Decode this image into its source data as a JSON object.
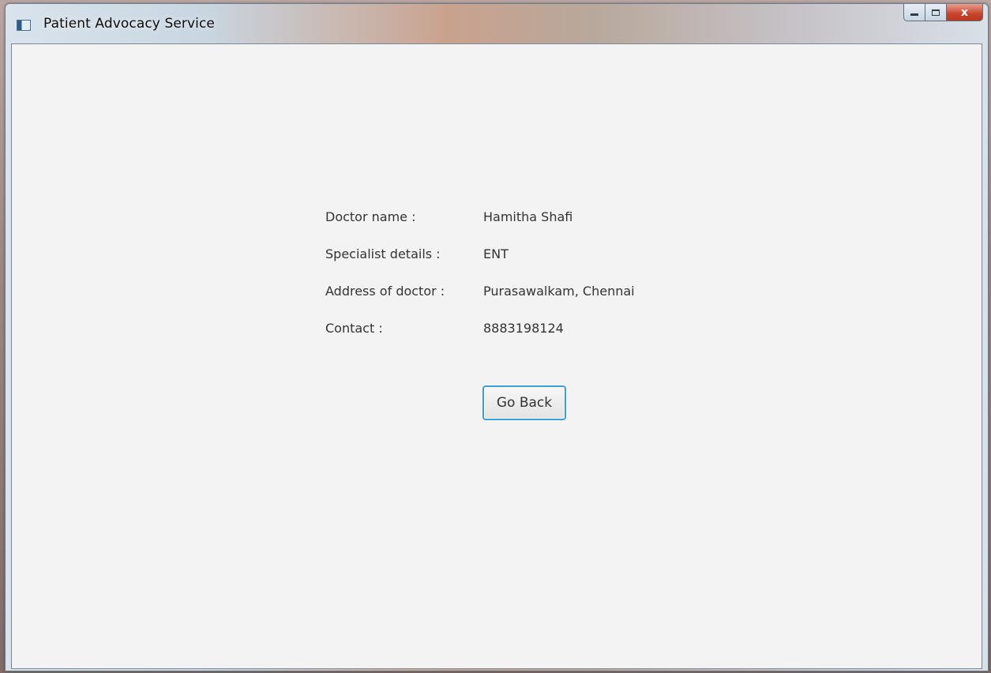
{
  "window": {
    "title": "Patient Advocacy Service",
    "caption_buttons": {
      "minimize": "minimize-icon",
      "maximize": "maximize-icon",
      "close": "x"
    }
  },
  "details": {
    "rows": [
      {
        "label": "Doctor name :",
        "value": "Hamitha Shafi"
      },
      {
        "label": "Specialist details :",
        "value": "ENT"
      },
      {
        "label": "Address of doctor :",
        "value": "Purasawalkam, Chennai"
      },
      {
        "label": "Contact :",
        "value": "8883198124"
      }
    ]
  },
  "actions": {
    "go_back_label": "Go Back"
  },
  "colors": {
    "window_background": "#f3f3f3",
    "text": "#333333",
    "button_focus_border": "#3ba0d9",
    "close_button": "#c7432b"
  }
}
